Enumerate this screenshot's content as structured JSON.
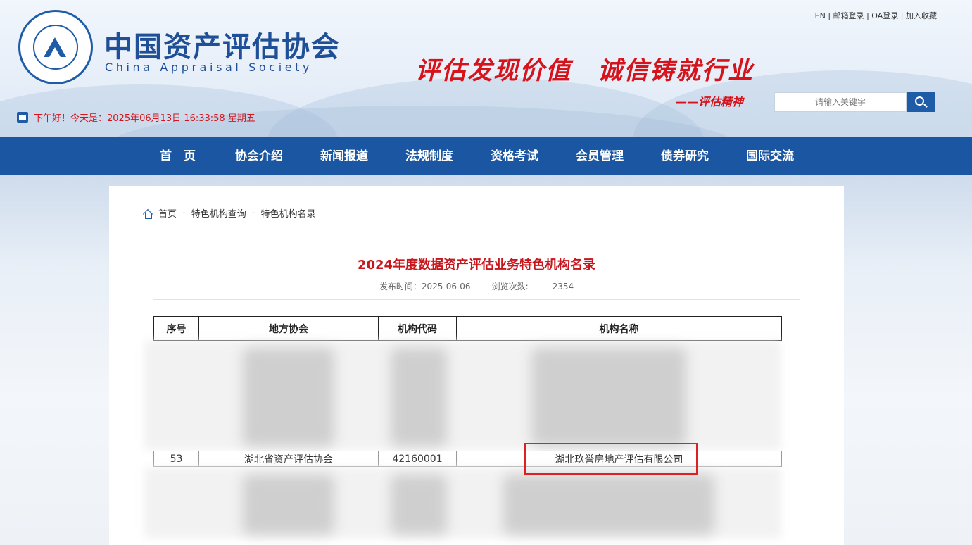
{
  "header": {
    "site_name": "中国资产评估协会",
    "site_name_en": "China Appraisal Society",
    "slogan": "评估发现价值　诚信铸就行业",
    "slogan_sub": "——评估精神",
    "top_links": [
      "EN",
      "邮箱登录",
      "OA登录",
      "加入收藏"
    ],
    "top_sep": "|",
    "search_placeholder": "请输入关键字",
    "date_text": "下午好！今天是：2025年06月13日 16:33:58 星期五"
  },
  "nav": {
    "items": [
      "首　页",
      "协会介绍",
      "新闻报道",
      "法规制度",
      "资格考试",
      "会员管理",
      "债券研究",
      "国际交流"
    ]
  },
  "breadcrumb": {
    "items": [
      "首页",
      "特色机构查询",
      "特色机构名录"
    ],
    "sep": "-"
  },
  "article": {
    "title": "2024年度数据资产评估业务特色机构名录",
    "publish_label": "发布时间：",
    "publish_date": "2025-06-06",
    "views_label": "浏览次数:",
    "views": "2354"
  },
  "table": {
    "headers": [
      "序号",
      "地方协会",
      "机构代码",
      "机构名称"
    ],
    "visible_row": {
      "index": "53",
      "association": "湖北省资产评估协会",
      "code": "42160001",
      "name": "湖北玖誉房地产评估有限公司"
    }
  },
  "colors": {
    "brand_blue": "#1a56a1",
    "red": "#d6131b",
    "highlight": "#e02020"
  }
}
